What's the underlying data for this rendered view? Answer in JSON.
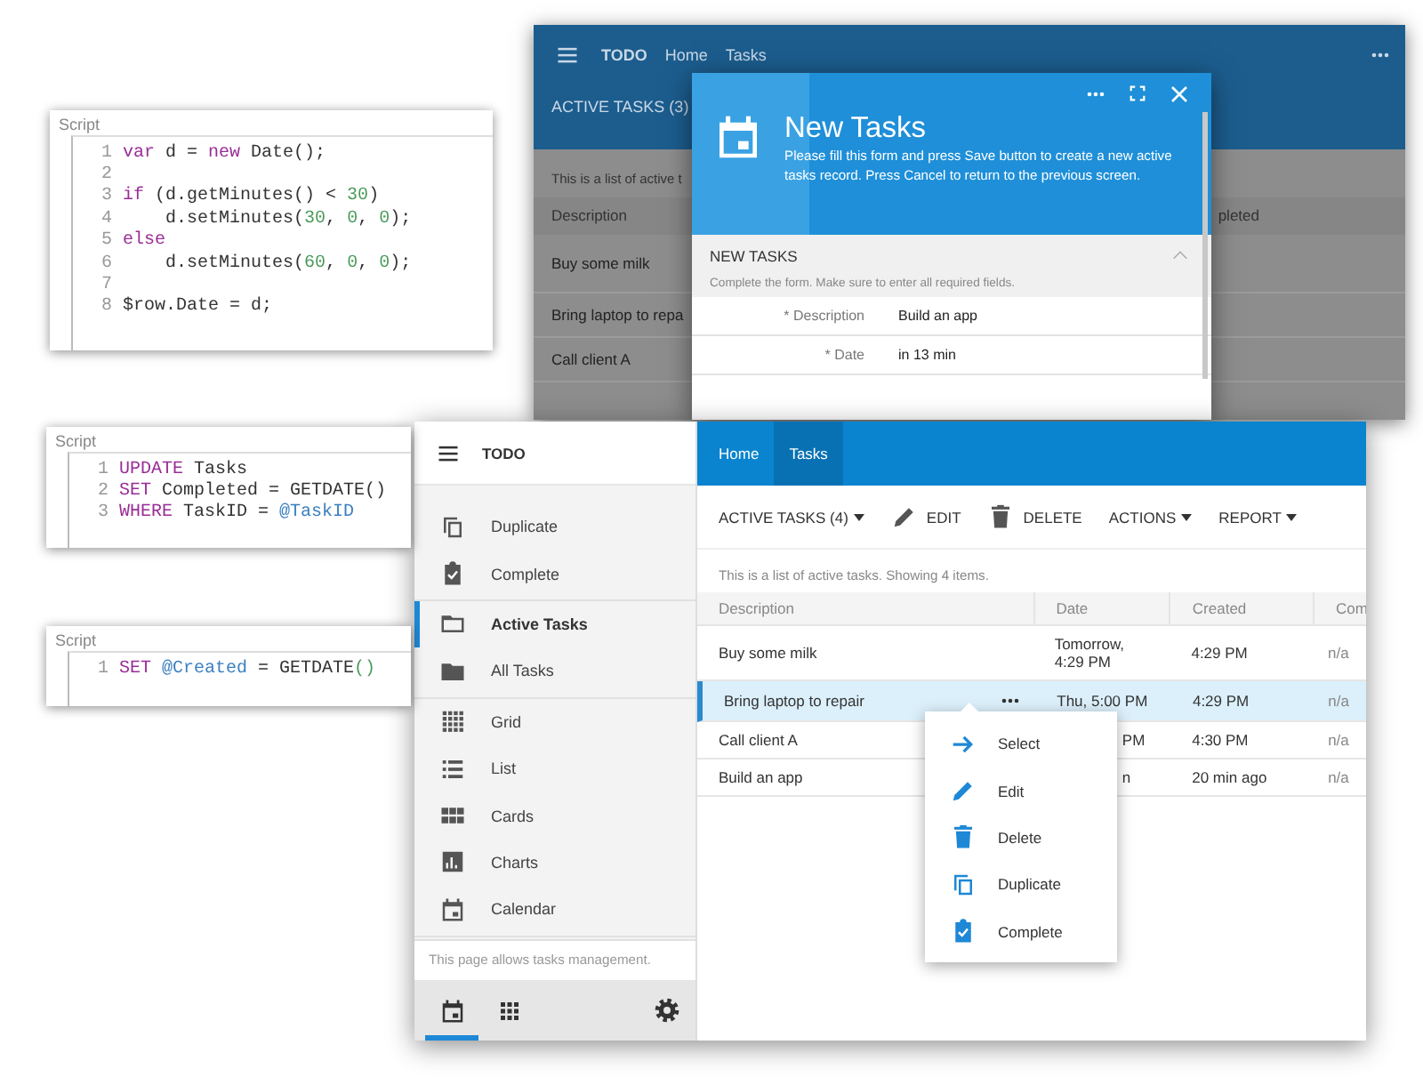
{
  "script_panels": [
    {
      "title": "Script",
      "lines": [
        {
          "number": "1",
          "tokens": [
            {
              "text": "var",
              "kind": "keyword"
            },
            {
              "text": " d = ",
              "kind": "text"
            },
            {
              "text": "new",
              "kind": "keyword"
            },
            {
              "text": " Date();",
              "kind": "text"
            }
          ]
        },
        {
          "number": "2"
        },
        {
          "number": "3",
          "tokens": [
            {
              "text": "if",
              "kind": "keyword"
            },
            {
              "text": " (d.getMinutes() < ",
              "kind": "text"
            },
            {
              "text": "30",
              "kind": "number"
            },
            {
              "text": ")",
              "kind": "text"
            }
          ]
        },
        {
          "number": "4",
          "tokens": [
            {
              "text": "    d.setMinutes(",
              "kind": "text"
            },
            {
              "text": "30",
              "kind": "number"
            },
            {
              "text": ", ",
              "kind": "text"
            },
            {
              "text": "0",
              "kind": "number"
            },
            {
              "text": ", ",
              "kind": "text"
            },
            {
              "text": "0",
              "kind": "number"
            },
            {
              "text": ");",
              "kind": "text"
            }
          ]
        },
        {
          "number": "5",
          "tokens": [
            {
              "text": "else",
              "kind": "keyword"
            }
          ]
        },
        {
          "number": "6",
          "tokens": [
            {
              "text": "    d.setMinutes(",
              "kind": "text"
            },
            {
              "text": "60",
              "kind": "number"
            },
            {
              "text": ", ",
              "kind": "text"
            },
            {
              "text": "0",
              "kind": "number"
            },
            {
              "text": ", ",
              "kind": "text"
            },
            {
              "text": "0",
              "kind": "number"
            },
            {
              "text": ");",
              "kind": "text"
            }
          ]
        },
        {
          "number": "7"
        },
        {
          "number": "8",
          "tokens": [
            {
              "text": "$row.Date = d;",
              "kind": "text"
            }
          ]
        }
      ]
    },
    {
      "title": "Script",
      "lines": [
        {
          "number": "1",
          "tokens": [
            {
              "text": "UPDATE",
              "kind": "keyword"
            },
            {
              "text": " Tasks",
              "kind": "text"
            }
          ]
        },
        {
          "number": "2",
          "tokens": [
            {
              "text": "SET",
              "kind": "keyword"
            },
            {
              "text": " Completed = GETDATE()",
              "kind": "text"
            }
          ]
        },
        {
          "number": "3",
          "tokens": [
            {
              "text": "WHERE",
              "kind": "keyword"
            },
            {
              "text": " TaskID = ",
              "kind": "text"
            },
            {
              "text": "@TaskID",
              "kind": "param"
            }
          ]
        }
      ]
    },
    {
      "title": "Script",
      "lines": [
        {
          "number": "1",
          "tokens": [
            {
              "text": "SET",
              "kind": "keyword"
            },
            {
              "text": " @Created",
              "kind": "param"
            },
            {
              "text": " = GETDATE",
              "kind": "text"
            },
            {
              "text": "()",
              "kind": "number"
            }
          ]
        }
      ]
    }
  ],
  "background_window": {
    "app_title": "TODO",
    "nav": [
      "Home",
      "Tasks"
    ],
    "view_title": "ACTIVE TASKS (3)",
    "info": "This is a list of active t",
    "columns": [
      "Description",
      "pleted"
    ],
    "rows": [
      "Buy some milk",
      "Bring laptop to repa",
      "Call client A"
    ]
  },
  "dialog": {
    "title": "New Tasks",
    "description": "Please fill this form and press Save button to create a new active tasks record. Press Cancel to return to the previous screen.",
    "section": {
      "title": "NEW TASKS",
      "expanded": true,
      "hint": "Complete the form. Make sure to enter all required fields."
    },
    "fields": [
      {
        "label": "* Description",
        "value": "Build an app"
      },
      {
        "label": "* Date",
        "value": "in 13 min"
      }
    ]
  },
  "front_window": {
    "sidebar": {
      "app_title": "TODO",
      "groups": [
        [
          {
            "label": "Duplicate",
            "selected": false
          },
          {
            "label": "Complete",
            "selected": false
          }
        ],
        [
          {
            "label": "Active Tasks",
            "selected": true
          },
          {
            "label": "All Tasks",
            "selected": false
          }
        ],
        [
          {
            "label": "Grid",
            "selected": false
          },
          {
            "label": "List",
            "selected": false
          },
          {
            "label": "Cards",
            "selected": false
          },
          {
            "label": "Charts",
            "selected": false
          },
          {
            "label": "Calendar",
            "selected": false
          }
        ]
      ],
      "footer": "This page allows tasks management.",
      "bottom_tabs": [
        {
          "selected": true
        },
        {
          "selected": false
        }
      ]
    },
    "nav": [
      {
        "label": "Home",
        "selected": false
      },
      {
        "label": "Tasks",
        "selected": true
      }
    ],
    "toolbar": [
      {
        "kind": "dropdown",
        "label": "ACTIVE TASKS (4)"
      },
      {
        "kind": "button",
        "label": "EDIT"
      },
      {
        "kind": "button",
        "label": "DELETE"
      },
      {
        "kind": "dropdown",
        "label": "ACTIONS"
      },
      {
        "kind": "dropdown",
        "label": "REPORT"
      }
    ],
    "info": "This is a list of active tasks. Showing 4 items.",
    "table": {
      "columns": [
        "Description",
        "Date",
        "Created",
        "Com"
      ],
      "rows": [
        {
          "cells": [
            "Buy some milk",
            "Tomorrow, 4:29 PM",
            "4:29 PM",
            "n/a"
          ],
          "selected": false
        },
        {
          "cells": [
            "Bring laptop to repair",
            "Thu, 5:00 PM",
            "4:29 PM",
            "n/a"
          ],
          "selected": true
        },
        {
          "cells": [
            "Call client A",
            "PM",
            "4:30 PM",
            "n/a"
          ],
          "selected": false
        },
        {
          "cells": [
            "Build an app",
            "n",
            "20 min ago",
            "n/a"
          ],
          "selected": false
        }
      ]
    },
    "context_menu": {
      "items": [
        "Select",
        "Edit",
        "Delete",
        "Duplicate",
        "Complete"
      ]
    }
  }
}
